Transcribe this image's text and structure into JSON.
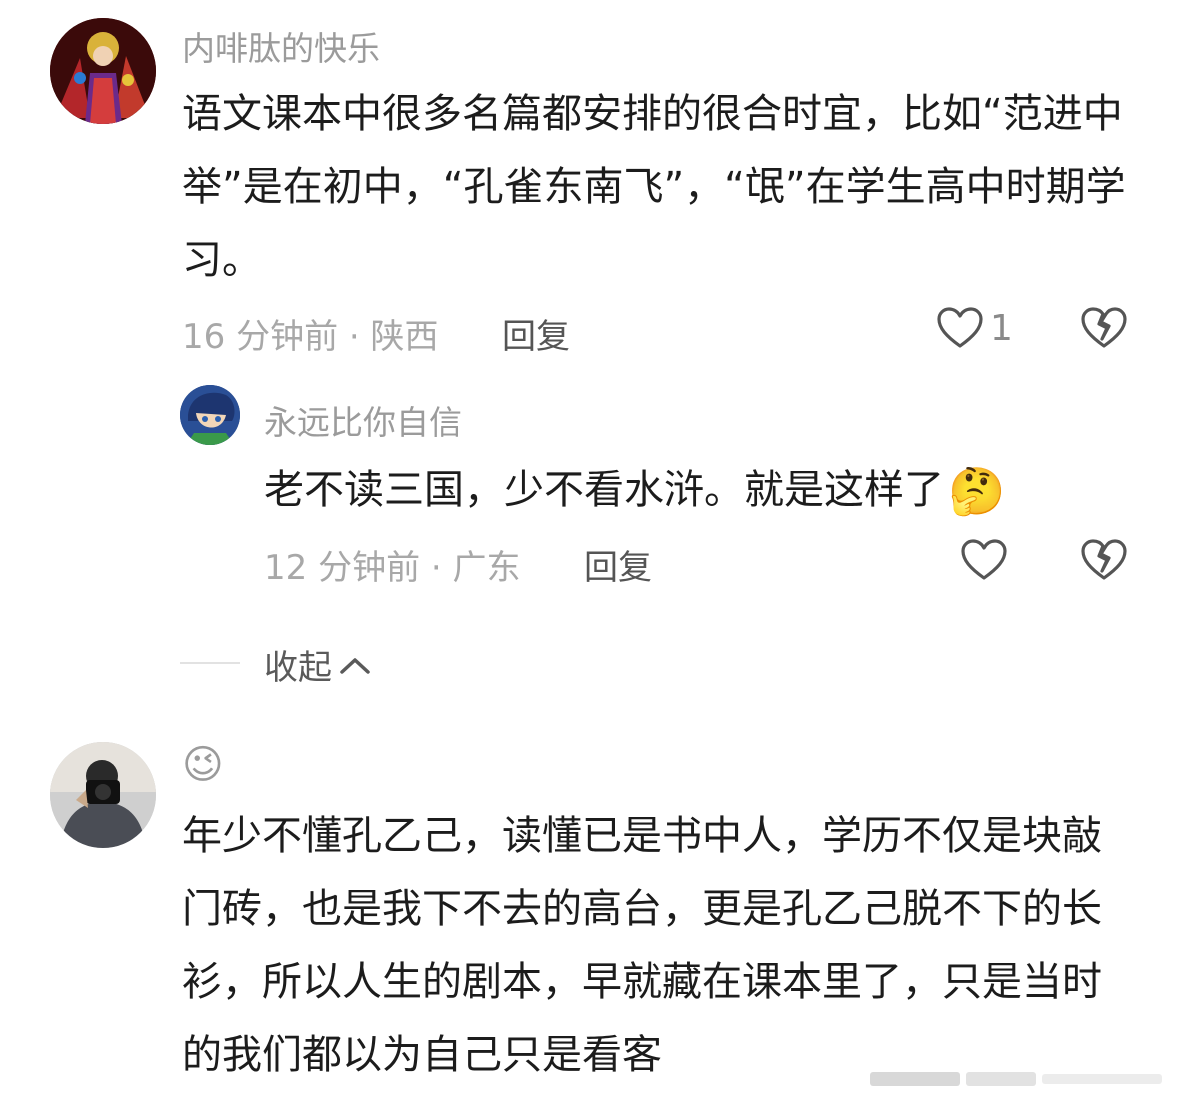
{
  "comments": [
    {
      "username": "内啡肽的快乐",
      "text": "语文课本中很多名篇都安排的很合时宜，比如“范进中举”是在初中，“孔雀东南飞”，“氓”在学生高中时期学习。",
      "time_location": "16 分钟前 · 陕西",
      "reply_label": "回复",
      "like_count": "1",
      "avatar_icon": "opera-avatar-icon"
    },
    {
      "username": "永远比你自信",
      "text": "老不读三国，少不看水浒。就是这样了",
      "emoji": "🤔",
      "time_location": "12 分钟前 · 广东",
      "reply_label": "回复",
      "like_count": "",
      "avatar_icon": "anime-avatar-icon"
    },
    {
      "username": "😉",
      "text": "年少不懂孔乙己，读懂已是书中人，学历不仅是块敲门砖，也是我下不去的高台，更是孔乙己脱不下的长衫，所以人生的剧本，早就藏在课本里了，只是当时的我们都以为自己只是看客",
      "avatar_icon": "photographer-avatar-icon"
    }
  ],
  "collapse": {
    "label": "收起",
    "icon": "chevron-up-icon"
  },
  "colors": {
    "text": "#1c1c1c",
    "username": "#9b9b9b",
    "meta": "#a8a8a8",
    "icon": "#555555"
  }
}
